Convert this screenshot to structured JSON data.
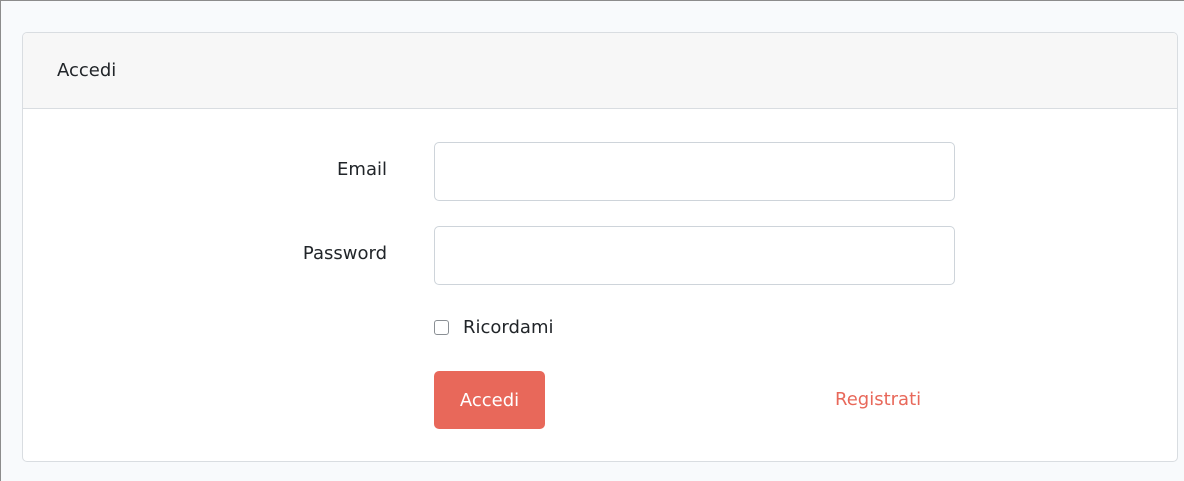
{
  "card": {
    "title": "Accedi"
  },
  "form": {
    "email_label": "Email",
    "email_value": "",
    "password_label": "Password",
    "password_value": "",
    "remember_label": "Ricordami",
    "remember_checked": false,
    "submit_label": "Accedi",
    "register_label": "Registrati"
  },
  "colors": {
    "accent": "#e8685a",
    "header_bg": "#f7f7f7",
    "page_bg": "#f8fafc"
  }
}
